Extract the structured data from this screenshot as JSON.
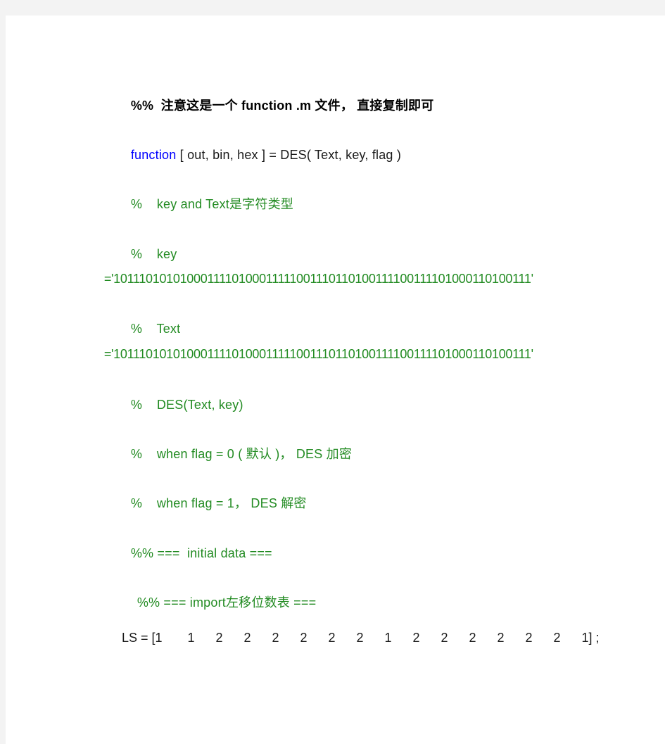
{
  "document": {
    "header_comment": {
      "prefix": "%%",
      "text": "注意这是一个 function .m 文件， 直接复制即可"
    },
    "function_line": {
      "keyword": "function",
      "signature": " [ out, bin, hex ] = DES( Text, key, flag )"
    },
    "comments": [
      {
        "prefix": "%",
        "text": "key and Text是字符类型"
      },
      {
        "prefix": "%",
        "text": "key"
      },
      {
        "prefix": "",
        "text": "='1011101010100011110100011111001110110100111100111101000110100111'"
      },
      {
        "prefix": "%",
        "text": "Text"
      },
      {
        "prefix": "",
        "text": "='1011101010100011110100011111001110110100111100111101000110100111'"
      },
      {
        "prefix": "%",
        "text": "DES(Text, key)"
      },
      {
        "prefix": "%",
        "text": "when flag = 0 ( 默认 )， DES 加密"
      },
      {
        "prefix": "%",
        "text": "when flag = 1， DES 解密"
      }
    ],
    "section_initial": "%% ===  initial data ===",
    "section_import": "%% === import左移位数表 ===",
    "ls_line": {
      "name": "LS",
      "values": [
        "1",
        "1",
        "2",
        "2",
        "2",
        "2",
        "2",
        "2",
        "1",
        "2",
        "2",
        "2",
        "2",
        "2",
        "2",
        "1"
      ],
      "open": "LS = [",
      "close": "] ;"
    }
  },
  "colors": {
    "comment": "#228b22",
    "keyword": "#0000ff",
    "text": "#1a1a1a",
    "background": "#f3f3f3",
    "page": "#ffffff"
  }
}
